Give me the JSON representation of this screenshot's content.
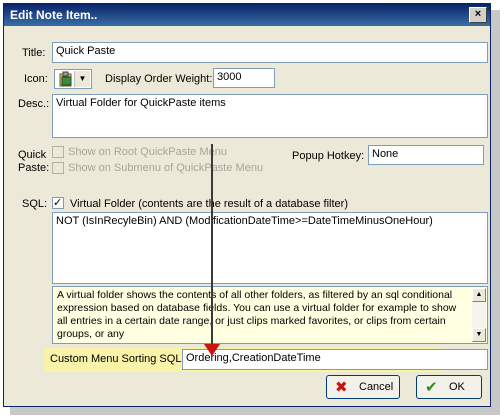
{
  "window": {
    "title": "Edit Note Item..",
    "close_glyph": "×"
  },
  "title_field": {
    "label": "Title:",
    "value": "Quick Paste"
  },
  "icon_field": {
    "label": "Icon:",
    "icon": "clipboard-icon"
  },
  "display_order": {
    "label": "Display Order Weight:",
    "value": "3000"
  },
  "desc": {
    "label": "Desc.:",
    "value": "Virtual Folder for QuickPaste items"
  },
  "quick_paste": {
    "label_line1": "Quick",
    "label_line2": "Paste:",
    "root_menu": "Show on Root QuickPaste Menu",
    "submenu": "Show on Submenu of QuickPaste Menu"
  },
  "popup_hotkey": {
    "label": "Popup Hotkey:",
    "value": "None"
  },
  "sql": {
    "label": "SQL:",
    "virtual_folder_checked": true,
    "virtual_folder_label": "Virtual Folder (contents are the result of a database filter)",
    "expression": "NOT (IsInRecyleBin) AND (ModificationDateTime>=DateTimeMinusOneHour)"
  },
  "info_text": "A virtual folder shows the contents of all other folders, as filtered by an sql conditional expression based on database fields.  You can use a virtual folder for example to show all entries in a certain date range, or just clips marked favorites, or clips from certain groups, or any",
  "sort_sql": {
    "label": "Custom Menu Sorting SQL:",
    "value": "Ordering,CreationDateTime"
  },
  "buttons": {
    "cancel": "Cancel",
    "ok": "OK"
  },
  "colors": {
    "titlebar": "#0a246a",
    "highlight": "#f8f3a8",
    "annotation_arrow": "#cc1111",
    "cancel_icon": "#cc1111",
    "ok_icon": "#2e8b22"
  }
}
